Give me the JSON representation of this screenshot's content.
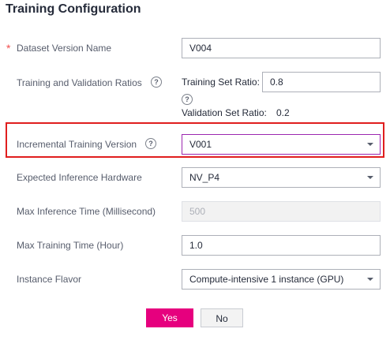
{
  "title": "Training Configuration",
  "fields": {
    "dataset_version": {
      "label": "Dataset Version Name",
      "value": "V004"
    },
    "ratios": {
      "label": "Training and Validation Ratios",
      "training_label": "Training Set Ratio:",
      "training_value": "0.8",
      "validation_label": "Validation Set Ratio:",
      "validation_value": "0.2"
    },
    "incremental": {
      "label": "Incremental Training Version",
      "value": "V001"
    },
    "hardware": {
      "label": "Expected Inference Hardware",
      "value": "NV_P4"
    },
    "max_inference": {
      "label": "Max Inference Time (Millisecond)",
      "value": "500"
    },
    "max_training": {
      "label": "Max Training Time (Hour)",
      "value": "1.0"
    },
    "flavor": {
      "label": "Instance Flavor",
      "value": "Compute-intensive 1 instance (GPU)"
    }
  },
  "buttons": {
    "yes": "Yes",
    "no": "No"
  },
  "help_glyph": "?",
  "required_glyph": "*",
  "colors": {
    "primary": "#e6007e",
    "highlight": "#e01e1e",
    "required": "#f24e4e"
  }
}
